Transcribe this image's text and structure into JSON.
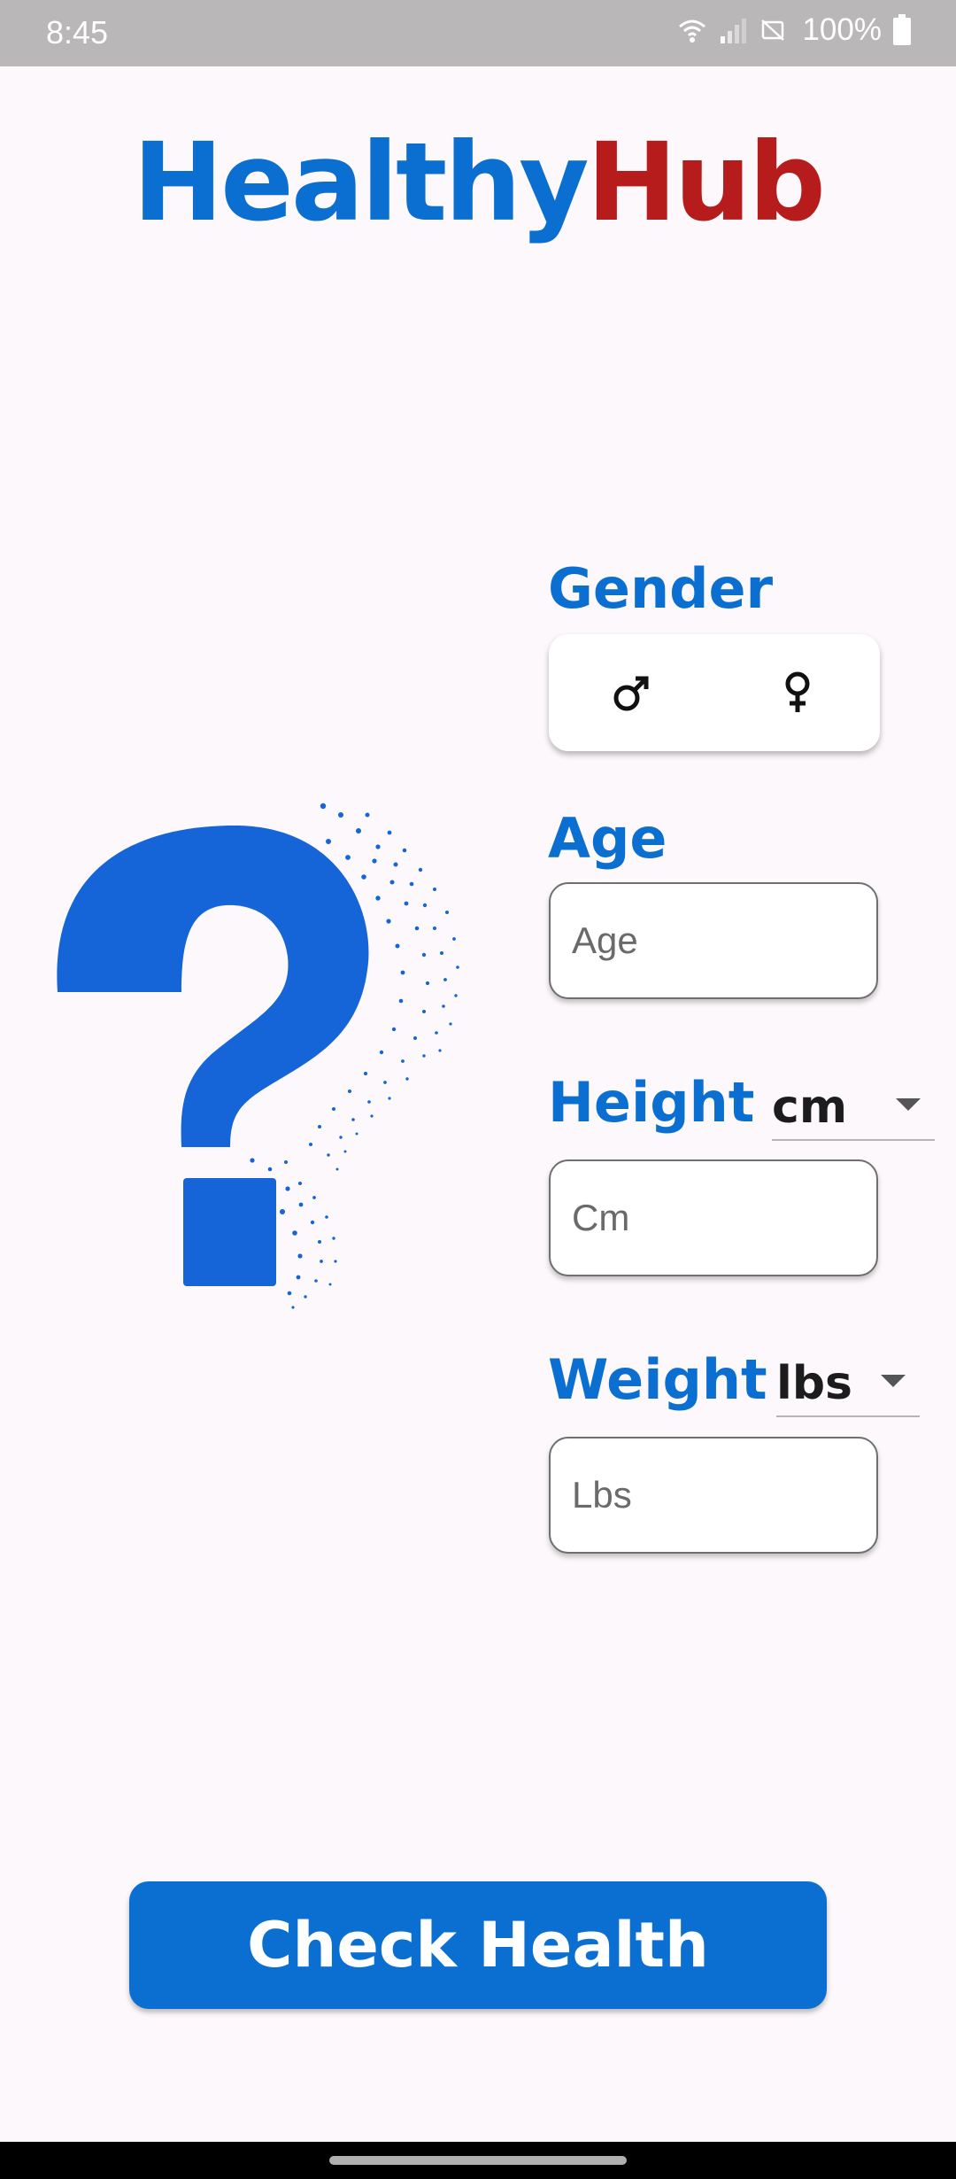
{
  "status_bar": {
    "time": "8:45",
    "battery": "100%",
    "icons": [
      "wifi-icon",
      "signal-icon",
      "no-sim-icon",
      "battery-icon"
    ]
  },
  "app": {
    "title_part1": "Healthy",
    "title_part2": "Hub",
    "title_color1": "#0a6fd0",
    "title_color2": "#b71c1c"
  },
  "form": {
    "gender": {
      "label": "Gender",
      "options": [
        {
          "icon": "male-symbol-icon",
          "symbol": "♂"
        },
        {
          "icon": "female-symbol-icon",
          "symbol": "♀"
        }
      ]
    },
    "age": {
      "label": "Age",
      "placeholder": "Age",
      "value": ""
    },
    "height": {
      "label": "Height",
      "unit": "cm",
      "placeholder": "Cm",
      "value": ""
    },
    "weight": {
      "label": "Weight",
      "unit": "lbs",
      "placeholder": "Lbs",
      "value": ""
    }
  },
  "illustration": {
    "icon": "question-mark-icon",
    "color": "#1565d8"
  },
  "actions": {
    "check_label": "Check Health",
    "accent": "#0a6fd0"
  }
}
